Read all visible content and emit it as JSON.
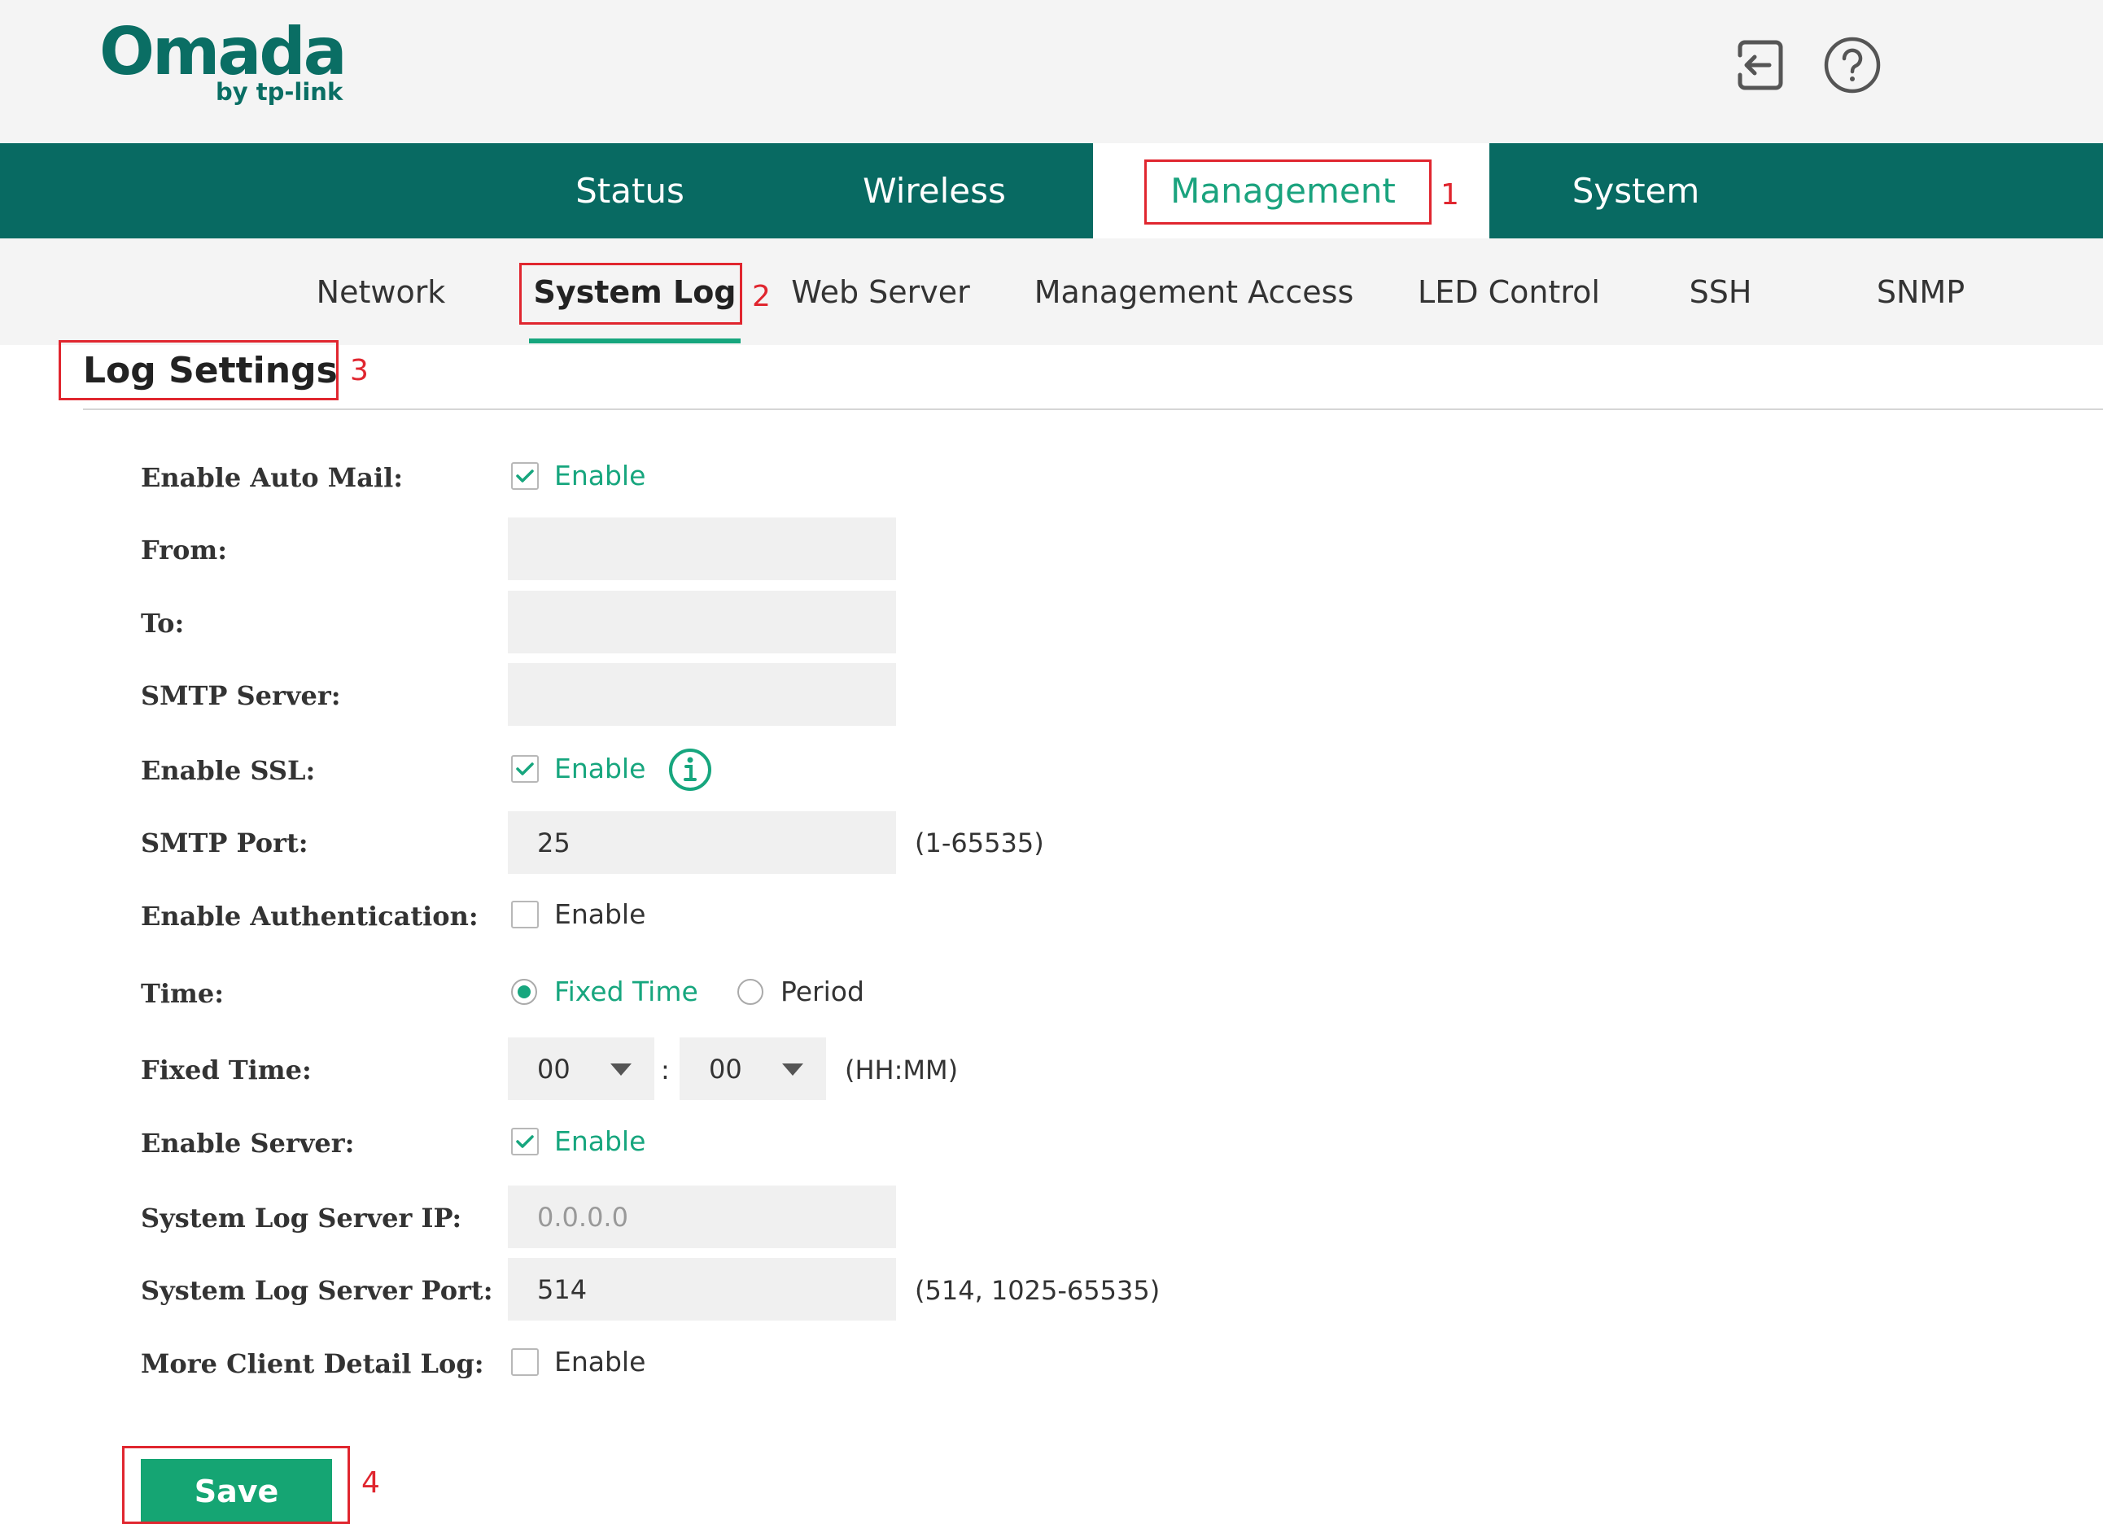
{
  "brand": {
    "name": "Omada",
    "subtitle": "by tp-link"
  },
  "header": {
    "icons": [
      "logout-icon",
      "help-icon"
    ]
  },
  "top_nav": {
    "tabs": [
      "Status",
      "Wireless",
      "Management",
      "System"
    ],
    "active": "Management"
  },
  "sub_nav": {
    "tabs": [
      "Network",
      "System Log",
      "Web Server",
      "Management Access",
      "LED Control",
      "SSH",
      "SNMP"
    ],
    "active": "System Log"
  },
  "annotations": [
    "1",
    "2",
    "3",
    "4"
  ],
  "section": {
    "title": "Log Settings"
  },
  "form": {
    "enable_auto_mail": {
      "label": "Enable Auto Mail:",
      "option": "Enable",
      "checked": true
    },
    "from": {
      "label": "From:",
      "value": ""
    },
    "to": {
      "label": "To:",
      "value": ""
    },
    "smtp_server": {
      "label": "SMTP Server:",
      "value": ""
    },
    "enable_ssl": {
      "label": "Enable SSL:",
      "option": "Enable",
      "checked": true,
      "info_icon": "info-icon"
    },
    "smtp_port": {
      "label": "SMTP Port:",
      "value": "25",
      "hint": "(1-65535)"
    },
    "enable_auth": {
      "label": "Enable Authentication:",
      "option": "Enable",
      "checked": false
    },
    "time": {
      "label": "Time:",
      "options": [
        "Fixed Time",
        "Period"
      ],
      "selected": "Fixed Time"
    },
    "fixed_time": {
      "label": "Fixed Time:",
      "hour": "00",
      "separator": ":",
      "minute": "00",
      "hint": "(HH:MM)"
    },
    "enable_server": {
      "label": "Enable Server:",
      "option": "Enable",
      "checked": true
    },
    "server_ip": {
      "label": "System Log Server IP:",
      "placeholder": "0.0.0.0"
    },
    "server_port": {
      "label": "System Log Server Port:",
      "value": "514",
      "hint": "(514, 1025-65535)"
    },
    "client_detail": {
      "label": "More Client Detail Log:",
      "option": "Enable",
      "checked": false
    }
  },
  "actions": {
    "save": "Save"
  },
  "colors": {
    "nav_bg": "#086a62",
    "accent": "#17a67e",
    "annotation": "#e0262f",
    "save_button": "#15a573"
  }
}
